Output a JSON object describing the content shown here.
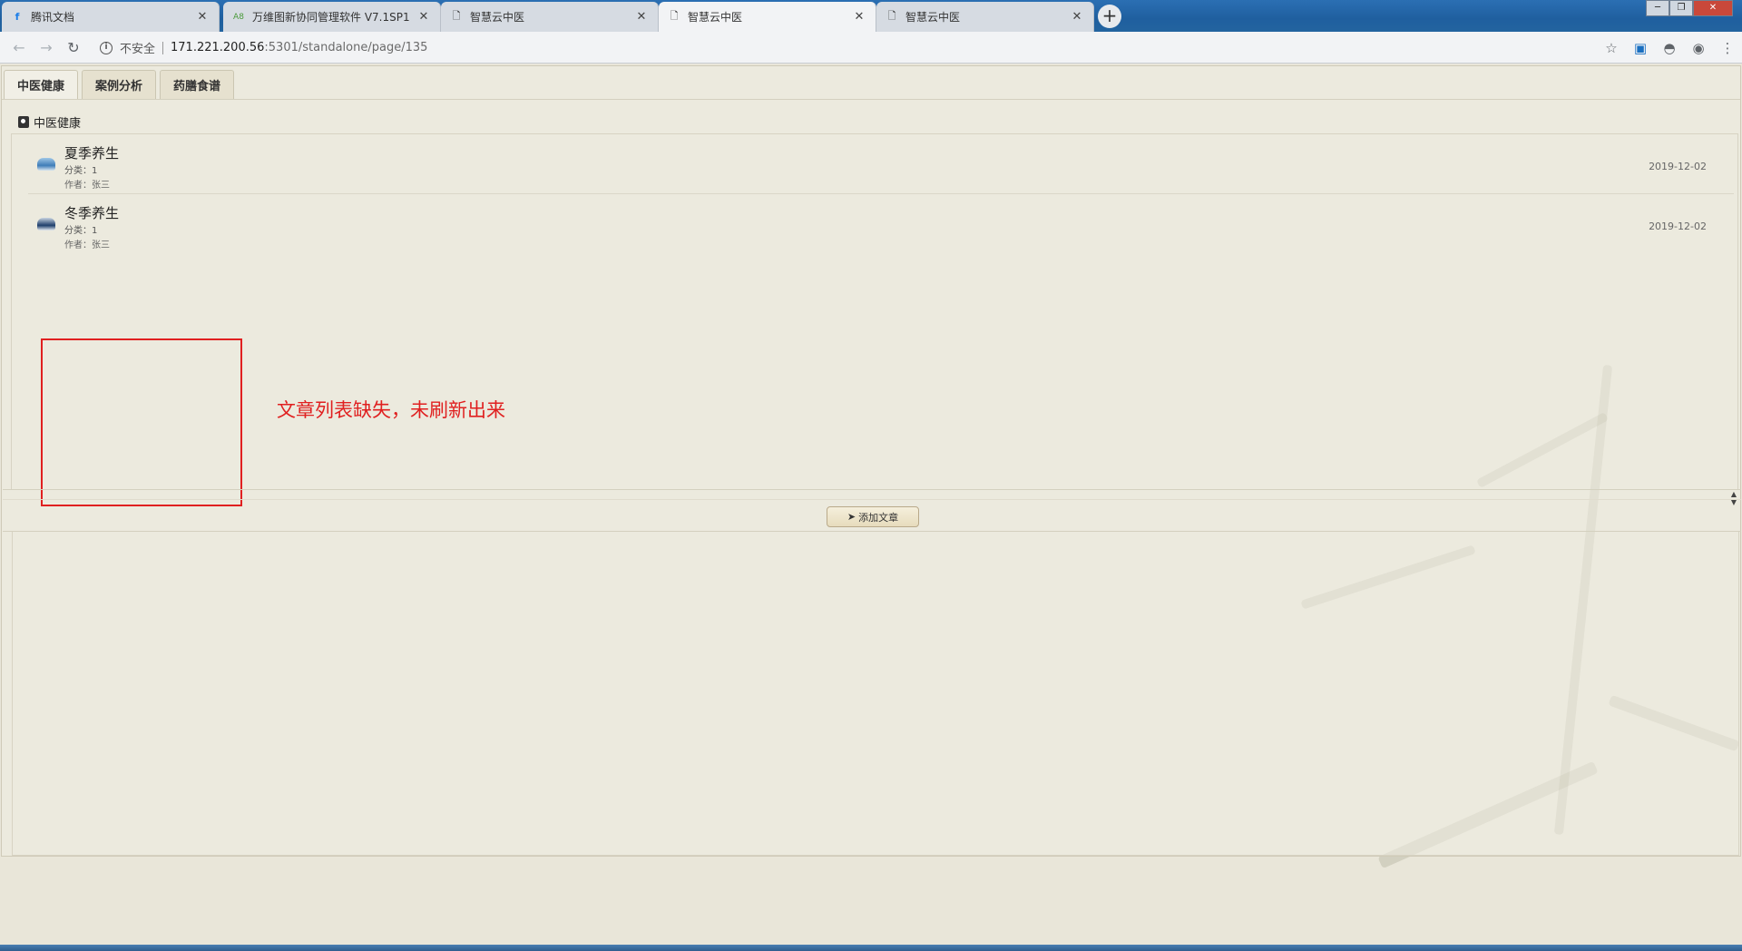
{
  "browser": {
    "tabs": [
      {
        "title": "腾讯文档",
        "favicon": "tencent-docs-icon",
        "active": false
      },
      {
        "title": "万维图新协同管理软件 V7.1SP1",
        "favicon": "a8-icon",
        "active": false
      },
      {
        "title": "智慧云中医",
        "favicon": "page-icon",
        "active": false
      },
      {
        "title": "智慧云中医",
        "favicon": "page-icon",
        "active": true
      },
      {
        "title": "智慧云中医",
        "favicon": "page-icon",
        "active": false
      }
    ],
    "security_label": "不安全",
    "url_host": "171.221.200.56",
    "url_rest": ":5301/standalone/page/135"
  },
  "page": {
    "tabs": [
      {
        "label": "中医健康",
        "active": true
      },
      {
        "label": "案例分析",
        "active": false
      },
      {
        "label": "药膳食谱",
        "active": false
      }
    ],
    "section_title": "中医健康",
    "articles": [
      {
        "title": "夏季养生",
        "category": "分类：1",
        "author": "作者：张三",
        "date": "2019-12-02",
        "thumb": "summer"
      },
      {
        "title": "冬季养生",
        "category": "分类：1",
        "author": "作者：张三",
        "date": "2019-12-02",
        "thumb": "winter"
      }
    ],
    "annotation": "文章列表缺失，未刷新出来",
    "add_button": "添加文章"
  },
  "colors": {
    "annotation": "#e02020",
    "background": "#e9e6d9"
  }
}
